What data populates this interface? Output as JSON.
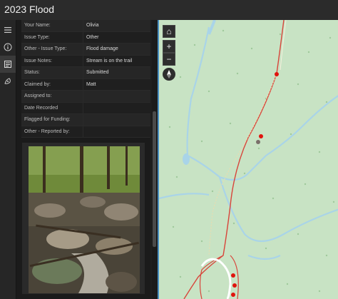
{
  "app": {
    "title": "2023 Flood"
  },
  "rail": {
    "items": [
      {
        "name": "layers-icon"
      },
      {
        "name": "info-icon"
      },
      {
        "name": "details-icon"
      },
      {
        "name": "basemap-icon"
      }
    ]
  },
  "attributes": [
    {
      "label": "Your Name:",
      "value": "Olivia"
    },
    {
      "label": "Issue Type:",
      "value": "Other"
    },
    {
      "label": "Other - Issue Type:",
      "value": "Flood damage"
    },
    {
      "label": "Issue Notes:",
      "value": "Stream is on the trail"
    },
    {
      "label": "Status:",
      "value": "Submitted"
    },
    {
      "label": "Claimed by:",
      "value": "Matt"
    },
    {
      "label": "Assigned to:",
      "value": ""
    },
    {
      "label": "Date Recorded",
      "value": ""
    },
    {
      "label": "Flagged for Funding:",
      "value": ""
    },
    {
      "label": "Other - Reported by:",
      "value": ""
    }
  ],
  "map": {
    "controls": {
      "home": "⌂",
      "zoom_in": "+",
      "zoom_out": "−"
    },
    "colors": {
      "land": "#c8e3c4",
      "water": "#a9d4e8",
      "trail": "#d8443a",
      "marker": "#e0140e"
    }
  }
}
